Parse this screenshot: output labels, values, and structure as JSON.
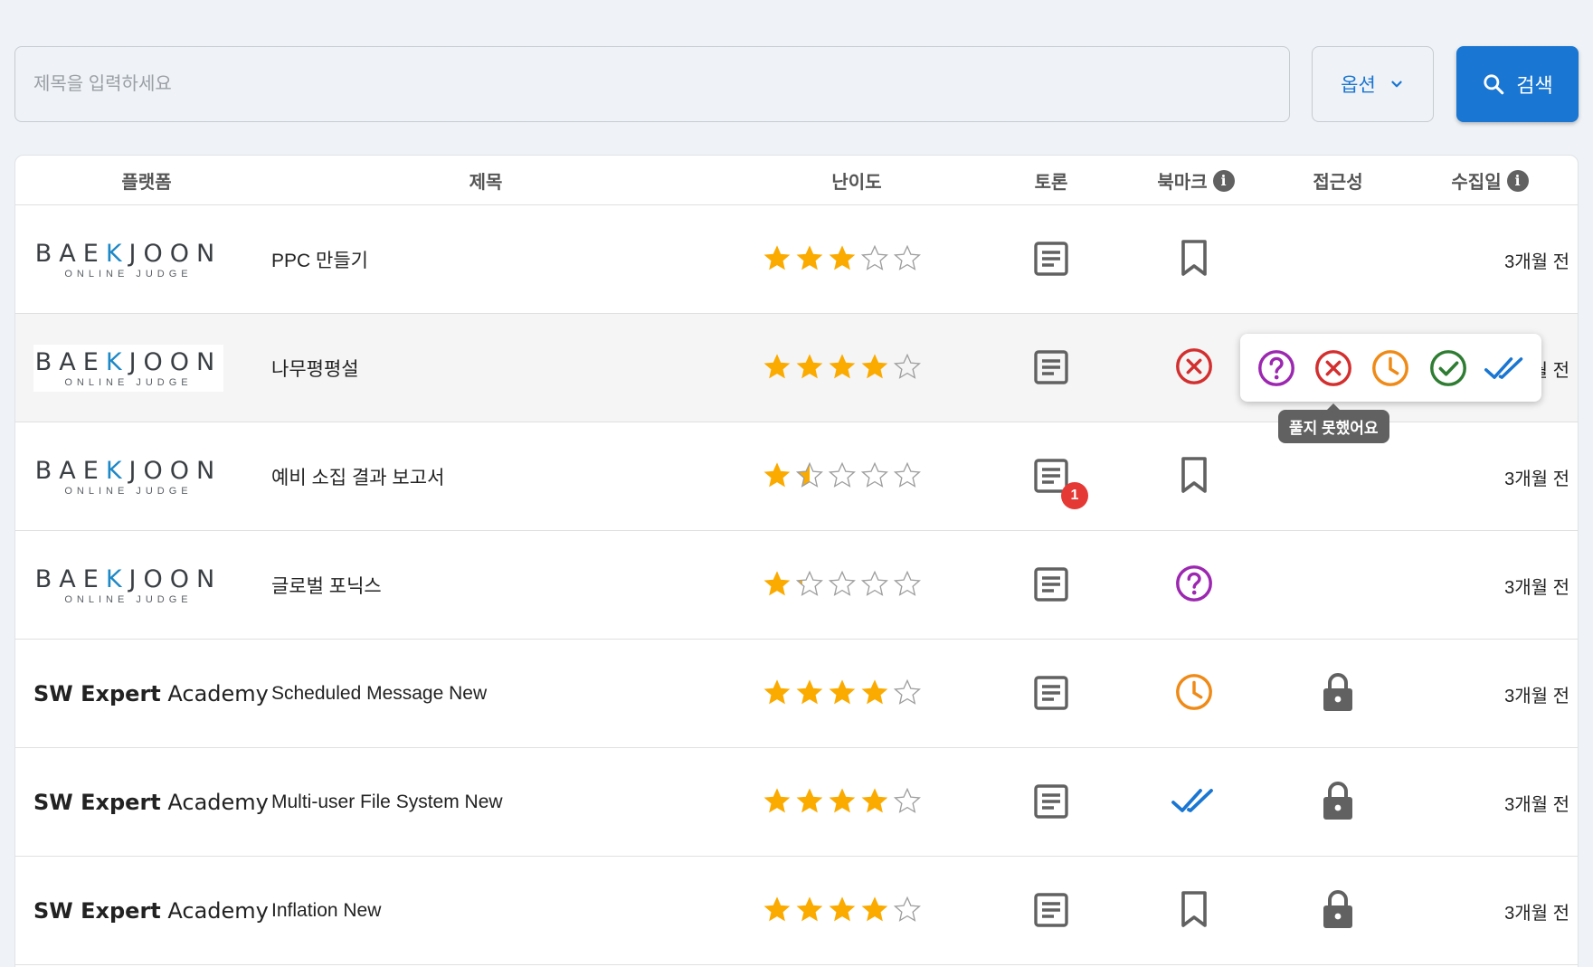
{
  "search": {
    "placeholder": "제목을 입력하세요",
    "value": ""
  },
  "options_button": {
    "label": "옵션",
    "icon": "chevron-down-icon"
  },
  "search_button": {
    "label": "검색",
    "icon": "search-icon"
  },
  "colors": {
    "primary": "#1976d2",
    "star": "#fbab00",
    "question": "#9c27b0",
    "fail": "#d32f2f",
    "pending": "#ef8a17",
    "solved": "#2e7d32",
    "reviewed": "#1976d2",
    "icon_gray": "#616161"
  },
  "table": {
    "headers": {
      "platform": "플랫폼",
      "title": "제목",
      "difficulty": "난이도",
      "discussion": "토론",
      "bookmark": "북마크",
      "accessibility": "접근성",
      "collected": "수집일"
    },
    "rows": [
      {
        "platform": "baekjoon",
        "title": "PPC 만들기",
        "stars": 3,
        "discussion_count": null,
        "bookmark": "bookmark",
        "locked": false,
        "date": "3개월 전"
      },
      {
        "platform": "baekjoon",
        "title": "나무평평설",
        "stars": 4,
        "discussion_count": null,
        "bookmark": "fail",
        "locked": false,
        "date": "3개월 전"
      },
      {
        "platform": "baekjoon",
        "title": "예비 소집 결과 보고서",
        "stars": 1.5,
        "discussion_count": "1",
        "bookmark": "bookmark",
        "locked": false,
        "date": "3개월 전"
      },
      {
        "platform": "baekjoon",
        "title": "글로벌 포닉스",
        "stars": 1.2,
        "discussion_count": null,
        "bookmark": "question",
        "locked": false,
        "date": "3개월 전"
      },
      {
        "platform": "swea",
        "title": "Scheduled Message New",
        "stars": 4,
        "discussion_count": null,
        "bookmark": "pending",
        "locked": true,
        "date": "3개월 전"
      },
      {
        "platform": "swea",
        "title": "Multi-user File System New",
        "stars": 4,
        "discussion_count": null,
        "bookmark": "reviewed",
        "locked": true,
        "date": "3개월 전"
      },
      {
        "platform": "swea",
        "title": "Inflation New",
        "stars": 4,
        "discussion_count": null,
        "bookmark": "bookmark",
        "locked": true,
        "date": "3개월 전"
      }
    ]
  },
  "logos": {
    "baekjoon_main": "BAEKJOON",
    "baekjoon_sub": "ONLINE JUDGE",
    "swea_bold": "SW Expert",
    "swea_normal": "Academy"
  },
  "popover": {
    "options": [
      "question",
      "fail",
      "pending",
      "solved",
      "reviewed"
    ],
    "tooltip": "풀지 못했어요"
  }
}
